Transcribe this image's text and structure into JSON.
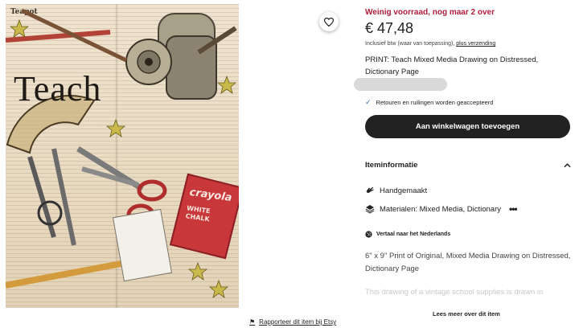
{
  "image": {
    "dictionary_header": "Teapot",
    "headword": "Teach",
    "crayola_brand": "crayola",
    "crayola_sub": "WHITE\nCHALK"
  },
  "favorite_icon": "heart-icon",
  "report": {
    "flag_icon": "flag-icon",
    "label": "Rapporteer dit item bij Etsy"
  },
  "product": {
    "stock_message": "Weinig voorraad, nog maar 2 over",
    "price": "€ 47,48",
    "tax_note": "Inclusief btw (waar van toepassing),",
    "shipping_link": "plus verzending",
    "title": "PRINT: Teach Mixed Media Drawing on Distressed, Dictionary Page",
    "returns": "Retouren en ruilingen worden geaccepteerd",
    "add_to_cart": "Aan winkelwagen toevoegen"
  },
  "item_info": {
    "heading": "Iteminformatie",
    "handmade": "Handgemaakt",
    "materials": "Materialen: Mixed Media, Dictionary",
    "more_dots": "•••",
    "translated_note": "Vertaal naar het Nederlands",
    "description": "6\" x 9\" Print of Original, Mixed Media Drawing on Distressed, Dictionary Page",
    "description_faded": "This drawing of a vintage school supplies is drawn in",
    "read_more": "Lees meer over dit item"
  },
  "colors": {
    "stock_red": "#b11d3a",
    "button_bg": "#222222",
    "check_blue": "#2b6cb0"
  }
}
